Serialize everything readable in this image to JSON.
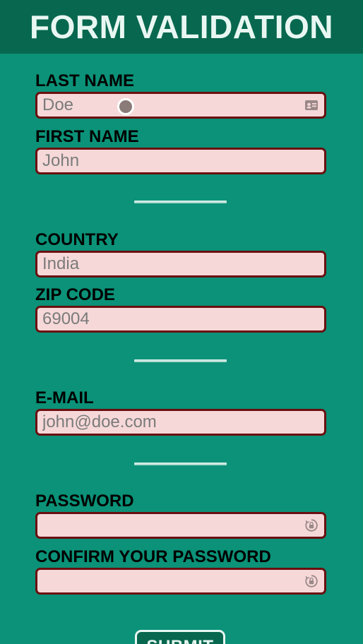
{
  "header": {
    "title": "FORM VALIDATION"
  },
  "fields": {
    "last_name": {
      "label": "LAST NAME",
      "placeholder": "Doe",
      "value": "",
      "icon": "contact-card-icon"
    },
    "first_name": {
      "label": "FIRST NAME",
      "placeholder": "John",
      "value": ""
    },
    "country": {
      "label": "COUNTRY",
      "placeholder": "India",
      "value": ""
    },
    "zip": {
      "label": "ZIP CODE",
      "placeholder": "69004",
      "value": ""
    },
    "email": {
      "label": "E-MAIL",
      "placeholder": "john@doe.com",
      "value": ""
    },
    "password": {
      "label": "PASSWORD",
      "placeholder": "",
      "value": "",
      "icon": "password-key-icon"
    },
    "confirm": {
      "label": "CONFIRM YOUR PASSWORD",
      "placeholder": "",
      "value": "",
      "icon": "password-key-icon"
    }
  },
  "submit": {
    "label": "SUBMIT"
  },
  "colors": {
    "background": "#0b9278",
    "header": "#07684f",
    "field_fill": "#f6d8d8",
    "field_border": "#6a0f10",
    "title_text": "#e9f7f2"
  }
}
